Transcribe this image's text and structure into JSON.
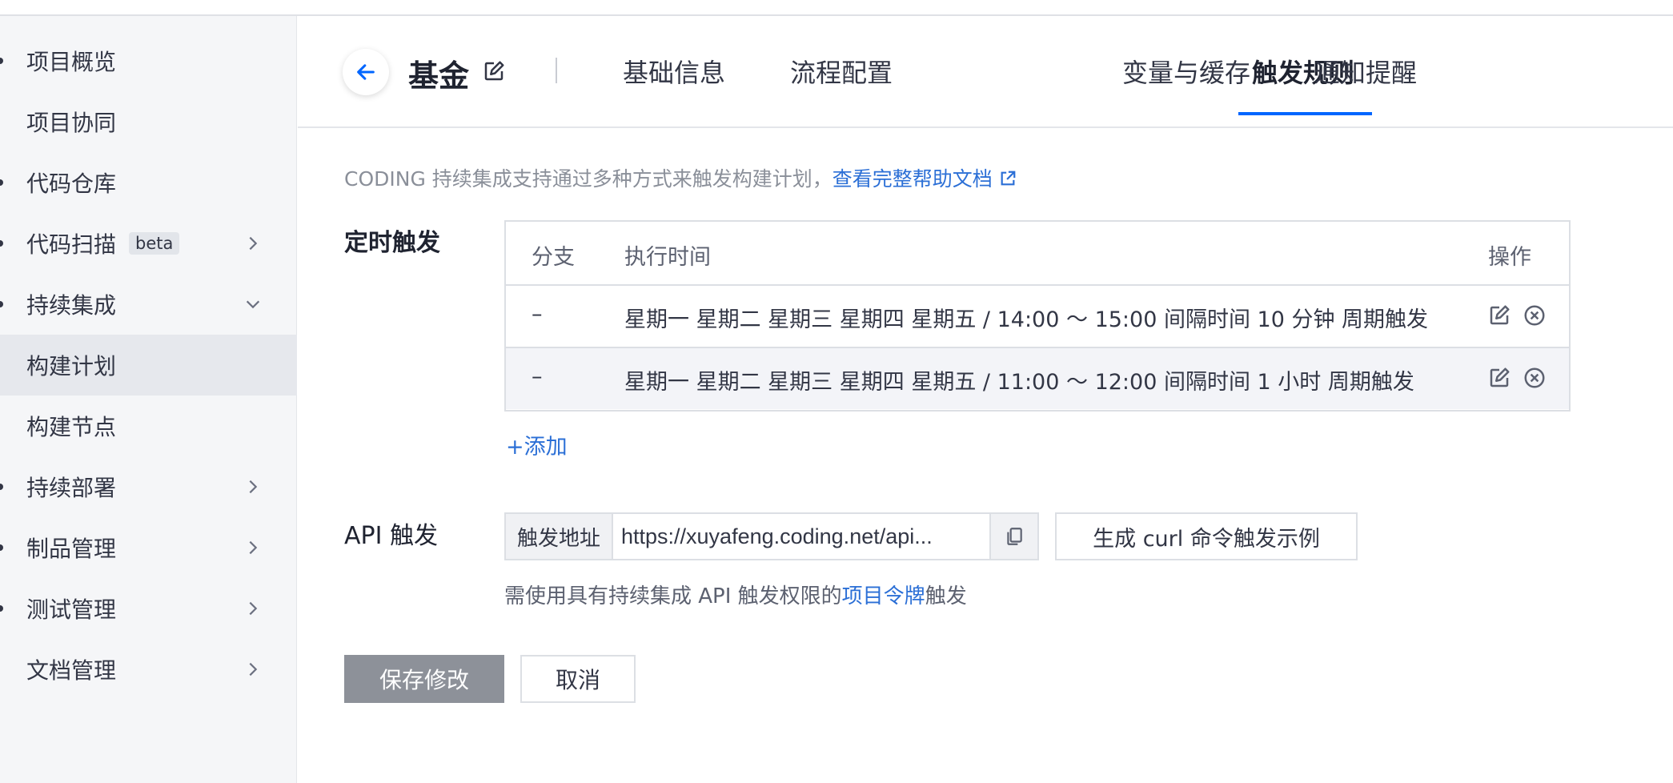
{
  "sidebar": {
    "items": [
      {
        "label": "项目概览"
      },
      {
        "label": "项目协同"
      },
      {
        "label": "代码仓库"
      },
      {
        "label": "代码扫描",
        "badge": "beta",
        "chevron": "chevron-right-icon"
      },
      {
        "label": "持续集成",
        "chevron": "chevron-down-icon"
      },
      {
        "label": "构建计划",
        "active": true
      },
      {
        "label": "构建节点"
      },
      {
        "label": "持续部署",
        "chevron": "chevron-right-icon"
      },
      {
        "label": "制品管理",
        "chevron": "chevron-right-icon"
      },
      {
        "label": "测试管理",
        "chevron": "chevron-right-icon"
      },
      {
        "label": "文档管理",
        "chevron": "chevron-right-icon"
      }
    ]
  },
  "header": {
    "back_icon": "arrow-left-icon",
    "title": "基金",
    "edit_icon": "edit-icon",
    "tabs": [
      {
        "label": "基础信息"
      },
      {
        "label": "流程配置"
      },
      {
        "label": "触发规则",
        "active": true
      },
      {
        "label": "变量与缓存"
      },
      {
        "label": "通知提醒"
      }
    ]
  },
  "content": {
    "description": "CODING 持续集成支持通过多种方式来触发构建计划，",
    "help_link": "查看完整帮助文档",
    "help_link_icon": "external-link-icon",
    "schedule": {
      "label": "定时触发",
      "columns": [
        "分支",
        "执行时间",
        "操作"
      ],
      "rows": [
        {
          "branch": "–",
          "time": "星期一 星期二 星期三 星期四 星期五 / 14:00 ～ 15:00 间隔时间 10 分钟 周期触发"
        },
        {
          "branch": "–",
          "time": "星期一 星期二 星期三 星期四 星期五 / 11:00 ～ 12:00 间隔时间 1 小时 周期触发"
        }
      ],
      "add_label": "+添加"
    },
    "api": {
      "label": "API 触发",
      "prefix": "触发地址",
      "url": "https://xuyafeng.coding.net/api...",
      "copy_icon": "copy-icon",
      "curl_button": "生成 curl 命令触发示例",
      "hint_prefix": "需使用具有持续集成 API 触发权限的",
      "hint_link": "项目令牌",
      "hint_suffix": "触发"
    },
    "actions": {
      "save": "保存修改",
      "cancel": "取消"
    }
  },
  "colors": {
    "accent": "#0066ff",
    "link": "#2b6fd6",
    "save_button": "#8d9199",
    "sidebar_bg": "#f5f6f8",
    "sidebar_active": "#e6e8ed"
  }
}
